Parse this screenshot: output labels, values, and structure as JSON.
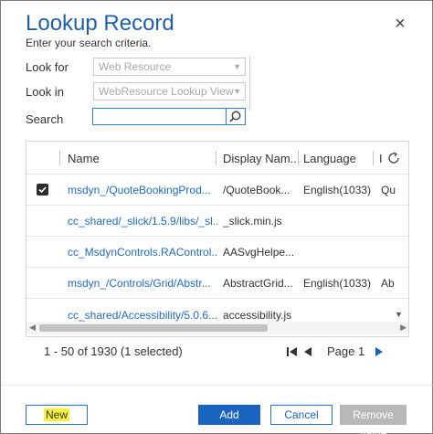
{
  "dialog": {
    "title": "Lookup Record",
    "subtitle": "Enter your search criteria.",
    "close_glyph": "×"
  },
  "form": {
    "look_for_label": "Look for",
    "look_for_value": "Web Resource",
    "look_in_label": "Look in",
    "look_in_value": "WebResource Lookup View",
    "search_label": "Search",
    "search_value": ""
  },
  "grid": {
    "columns": [
      "Name",
      "Display Nam...",
      "Language",
      "I"
    ],
    "rows": [
      {
        "name": "msdyn_/QuoteBookingProd...",
        "display": "/QuoteBook...",
        "language": "English(1033)",
        "extra": "Qu",
        "checked": true
      },
      {
        "name": "cc_shared/_slick/1.5.9/libs/_sl...",
        "display": "_slick.min.js",
        "language": "",
        "extra": "",
        "checked": false
      },
      {
        "name": "cc_MsdynControls.RAControl...",
        "display": "AASvgHelpe...",
        "language": "",
        "extra": "",
        "checked": false
      },
      {
        "name": "msdyn_/Controls/Grid/Abstr...",
        "display": "AbstractGrid...",
        "language": "English(1033)",
        "extra": "Ab",
        "checked": false
      },
      {
        "name": "cc_shared/Accessibility/5.0.6...",
        "display": "accessibility.js",
        "language": "",
        "extra": "",
        "checked": false
      }
    ]
  },
  "pager": {
    "summary": "1 - 50 of 1930 (1 selected)",
    "page_label": "Page 1"
  },
  "footer": {
    "new_label": "New",
    "add_label": "Add",
    "cancel_label": "Cancel",
    "remove_label": "Remove Value"
  },
  "colors": {
    "accent": "#1a63c1",
    "link": "#1f6bbf",
    "highlight": "#f6f43a",
    "disabled": "#b8b8b8"
  },
  "icons": [
    "close-icon",
    "dropdown-caret-icon",
    "search-icon",
    "checkbox-icon",
    "refresh-icon",
    "first-page-icon",
    "previous-page-icon",
    "next-page-icon"
  ]
}
